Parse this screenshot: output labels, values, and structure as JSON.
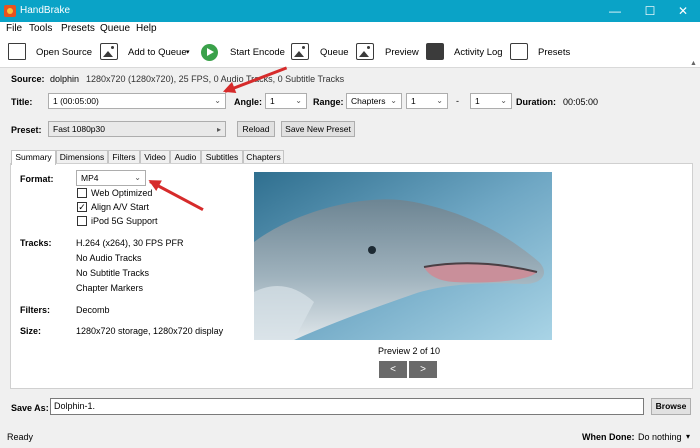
{
  "window": {
    "title": "HandBrake",
    "minimize": "—",
    "maximize": "☐",
    "close": "✕"
  },
  "menu": [
    "File",
    "Tools",
    "Presets",
    "Queue",
    "Help"
  ],
  "toolbar": {
    "open_source": "Open Source",
    "add_to_queue": "Add to Queue",
    "add_caret": "▾",
    "start_encode": "Start Encode",
    "queue": "Queue",
    "preview": "Preview",
    "activity_log": "Activity Log",
    "presets": "Presets"
  },
  "source": {
    "label": "Source:",
    "name": "dolphin",
    "info": "1280x720 (1280x720), 25 FPS, 0 Audio Tracks, 0 Subtitle Tracks"
  },
  "title_row": {
    "title_label": "Title:",
    "title_value": "1  (00:05:00)",
    "angle_label": "Angle:",
    "angle_value": "1",
    "range_label": "Range:",
    "range_value": "Chapters",
    "range_start": "1",
    "range_sep": "-",
    "range_end": "1",
    "duration_label": "Duration:",
    "duration_value": "00:05:00"
  },
  "preset_row": {
    "label": "Preset:",
    "value": "Fast 1080p30",
    "arrow": "▸",
    "reload": "Reload",
    "save_new": "Save New Preset"
  },
  "tabs": [
    "Summary",
    "Dimensions",
    "Filters",
    "Video",
    "Audio",
    "Subtitles",
    "Chapters"
  ],
  "summary": {
    "format_label": "Format:",
    "format_value": "MP4",
    "web_optimized": "Web Optimized",
    "web_optimized_checked": false,
    "align_av": "Align A/V Start",
    "align_av_checked": true,
    "ipod": "iPod 5G Support",
    "ipod_checked": false,
    "tracks_label": "Tracks:",
    "tracks": [
      "H.264 (x264), 30 FPS PFR",
      "No Audio Tracks",
      "No Subtitle Tracks",
      "Chapter Markers"
    ],
    "filters_label": "Filters:",
    "filters_value": "Decomb",
    "size_label": "Size:",
    "size_value": "1280x720 storage, 1280x720 display",
    "preview_caption": "Preview 2 of 10",
    "prev": "<",
    "next": ">"
  },
  "save_as": {
    "label": "Save As:",
    "value": "Dolphin-1.",
    "browse": "Browse"
  },
  "status": {
    "text": "Ready",
    "when_done_label": "When Done:",
    "when_done_value": "Do nothing",
    "caret": "▾"
  },
  "colors": {
    "titlebar": "#0aa3c7",
    "annotation_arrow": "#d62b2b",
    "start_green": "#3aa14a"
  }
}
